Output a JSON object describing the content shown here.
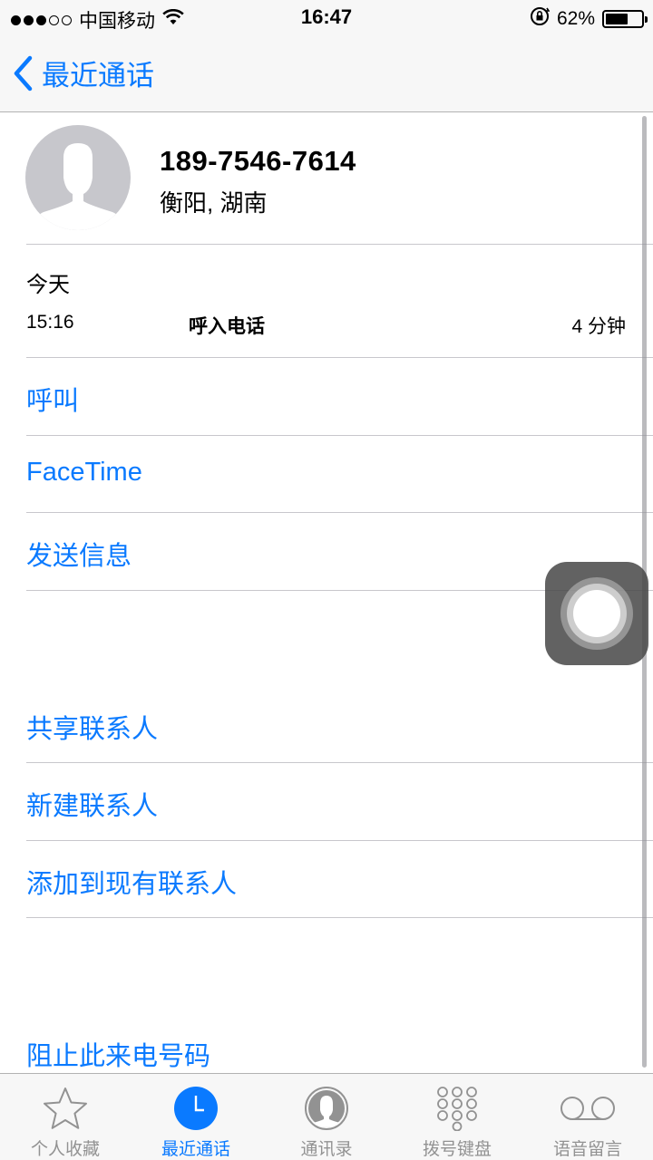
{
  "status_bar": {
    "carrier": "中国移动",
    "time": "16:47",
    "battery_percent": "62%",
    "battery_level": 0.62
  },
  "nav": {
    "back_label": "最近通话"
  },
  "contact": {
    "number": "189-7546-7614",
    "location": "衡阳, 湖南"
  },
  "call_info": {
    "day": "今天",
    "time": "15:16",
    "type": "呼入电话",
    "duration": "4 分钟"
  },
  "actions": {
    "call": "呼叫",
    "facetime": "FaceTime",
    "message": "发送信息",
    "share_contact": "共享联系人",
    "new_contact": "新建联系人",
    "add_to_existing": "添加到现有联系人",
    "block": "阻止此来电号码"
  },
  "tabs": [
    {
      "label": "个人收藏",
      "icon": "star-icon",
      "active": false
    },
    {
      "label": "最近通话",
      "icon": "clock-icon",
      "active": true
    },
    {
      "label": "通讯录",
      "icon": "contacts-icon",
      "active": false
    },
    {
      "label": "拨号键盘",
      "icon": "keypad-icon",
      "active": false
    },
    {
      "label": "语音留言",
      "icon": "voicemail-icon",
      "active": false
    }
  ],
  "colors": {
    "accent": "#0a7aff",
    "inactive": "#929292",
    "separator": "#c8c7cc"
  }
}
